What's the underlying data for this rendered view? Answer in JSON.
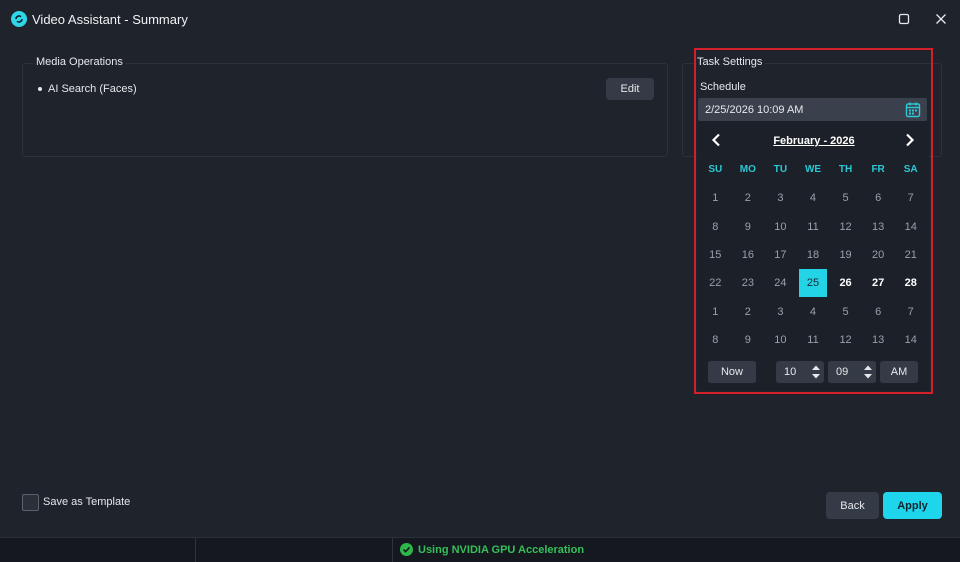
{
  "window": {
    "title": "Video Assistant - Summary",
    "icons": {
      "app": "app-logo-icon",
      "maximize": "maximize-icon",
      "close": "close-icon"
    }
  },
  "media_operations": {
    "legend": "Media Operations",
    "items": [
      "AI Search (Faces)"
    ],
    "edit_label": "Edit"
  },
  "task_settings": {
    "legend": "Task Settings",
    "schedule_label": "Schedule",
    "schedule_value": "2/25/2026 10:09 AM"
  },
  "calendar": {
    "month_label": "February - 2026",
    "weekdays": [
      "SU",
      "MO",
      "TU",
      "WE",
      "TH",
      "FR",
      "SA"
    ],
    "days": [
      "1",
      "2",
      "3",
      "4",
      "5",
      "6",
      "7",
      "8",
      "9",
      "10",
      "11",
      "12",
      "13",
      "14",
      "15",
      "16",
      "17",
      "18",
      "19",
      "20",
      "21",
      "22",
      "23",
      "24",
      "25",
      "26",
      "27",
      "28",
      "1",
      "2",
      "3",
      "4",
      "5",
      "6",
      "7",
      "8",
      "9",
      "10",
      "11",
      "12",
      "13",
      "14"
    ],
    "selected_day": "25",
    "now_label": "Now",
    "hour": "10",
    "minute": "09",
    "ampm": "AM"
  },
  "footer": {
    "save_template_label": "Save as Template",
    "back_label": "Back",
    "apply_label": "Apply"
  },
  "status": {
    "gpu_text": "Using NVIDIA GPU Acceleration"
  },
  "colors": {
    "accent": "#1fd5ec",
    "highlight": "#d3202a",
    "status_green": "#34c15a",
    "background": "#1f232b"
  }
}
